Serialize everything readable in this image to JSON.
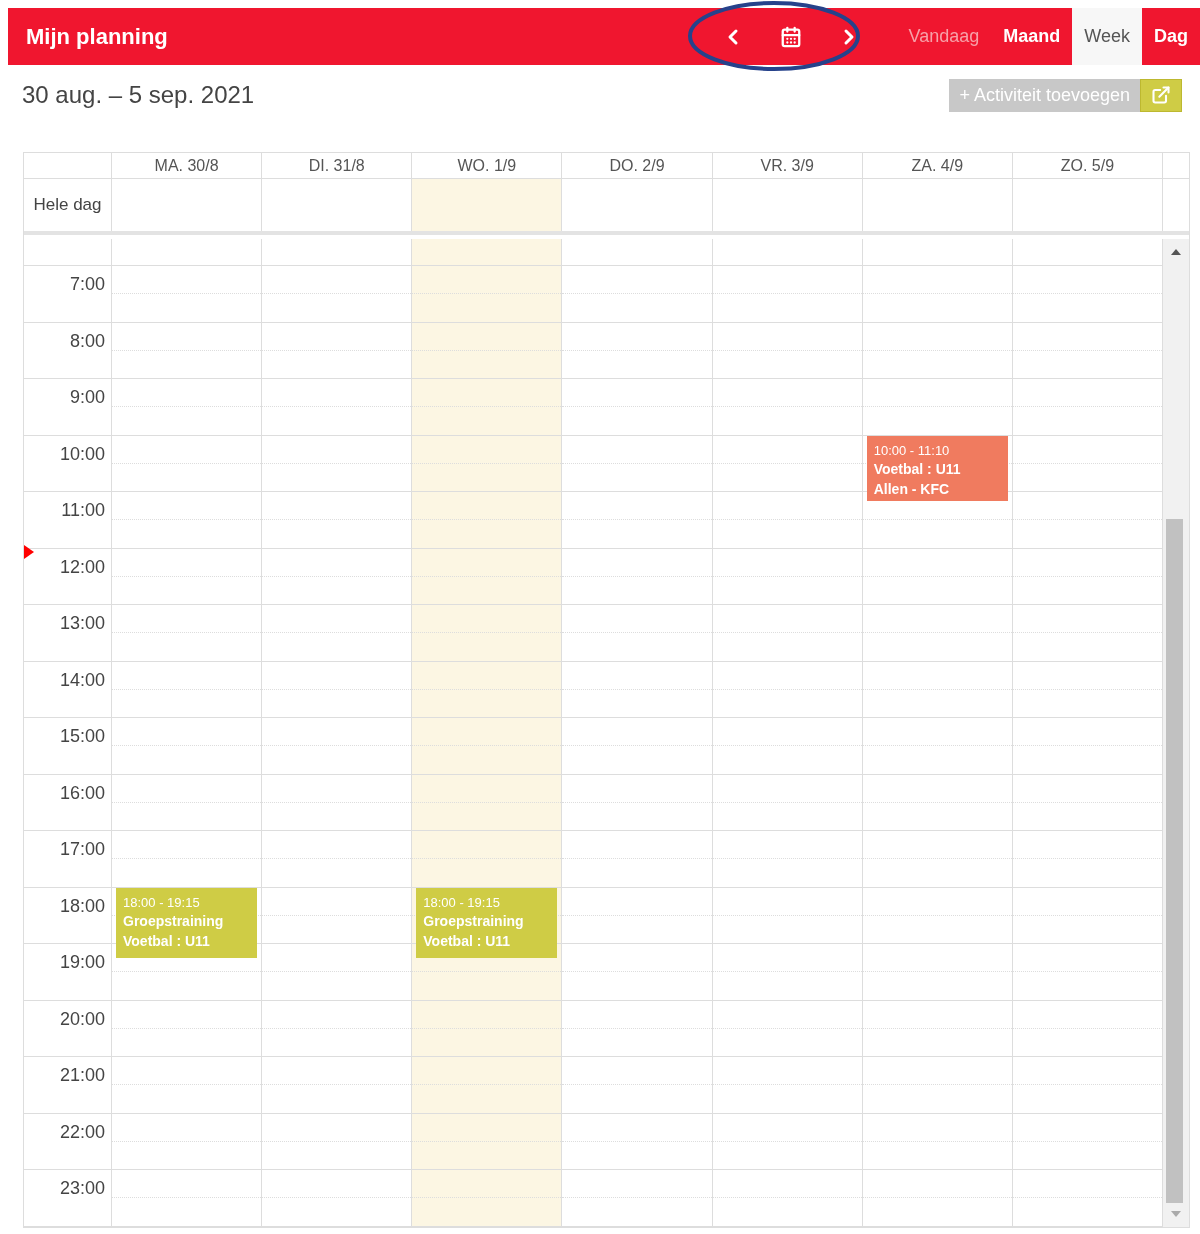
{
  "header": {
    "title": "Mijn planning",
    "today_button": {
      "label": "Vandaag",
      "disabled": true
    },
    "views": [
      {
        "label": "Maand",
        "selected": false
      },
      {
        "label": "Week",
        "selected": true
      },
      {
        "label": "Dag",
        "selected": false
      }
    ]
  },
  "range": "30 aug. – 5 sep. 2021",
  "add_button": "+ Activiteit toevoegen",
  "all_day_label": "Hele dag",
  "days": [
    {
      "label": "MA. 30/8",
      "today": false,
      "events": [
        {
          "time": "18:00 - 19:15",
          "lines": [
            "Groepstraining",
            "Voetbal : U11"
          ],
          "color": "#cfcc45"
        }
      ]
    },
    {
      "label": "DI. 31/8",
      "today": false
    },
    {
      "label": "WO. 1/9",
      "today": true,
      "events": [
        {
          "time": "18:00 - 19:15",
          "lines": [
            "Groepstraining",
            "Voetbal : U11"
          ],
          "color": "#cfcc45"
        }
      ]
    },
    {
      "label": "DO. 2/9",
      "today": false
    },
    {
      "label": "VR. 3/9",
      "today": false
    },
    {
      "label": "ZA. 4/9",
      "today": false,
      "events": [
        {
          "time": "10:00 - 11:10",
          "lines": [
            "Voetbal : U11",
            "Allen - KFC"
          ],
          "color": "#f07b5f"
        }
      ]
    },
    {
      "label": "ZO. 5/9",
      "today": false
    }
  ],
  "hours": [
    "7:00",
    "8:00",
    "9:00",
    "10:00",
    "11:00",
    "12:00",
    "13:00",
    "14:00",
    "15:00",
    "16:00",
    "17:00",
    "18:00",
    "19:00",
    "20:00",
    "21:00",
    "22:00",
    "23:00"
  ]
}
